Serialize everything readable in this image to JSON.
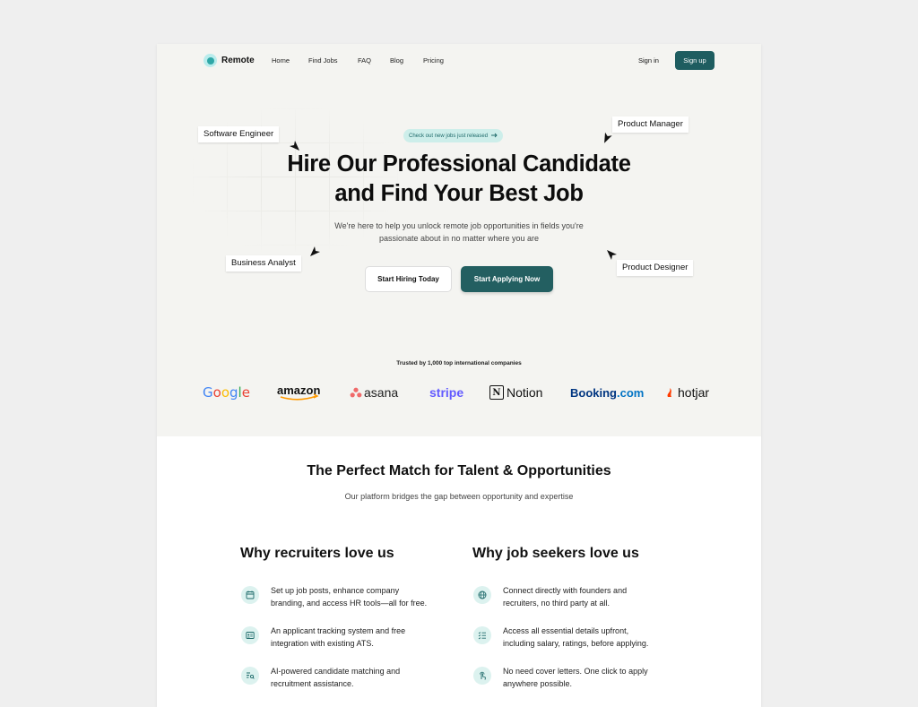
{
  "nav": {
    "brand": "Remote",
    "links": [
      "Home",
      "Find Jobs",
      "FAQ",
      "Blog",
      "Pricing"
    ],
    "signin": "Sign in",
    "signup": "Sign up"
  },
  "hero": {
    "announcement": "Check out new jobs just released",
    "headline_line1": "Hire Our Professional Candidate",
    "headline_line2": "and Find Your Best Job",
    "subtitle_line1": "We're here to help you unlock remote job opportunities in fields you're",
    "subtitle_line2": "passionate about in no matter where you are",
    "cta_hire": "Start Hiring Today",
    "cta_apply": "Start Applying Now",
    "tags": [
      "Software Engineer",
      "Product  Manager",
      "Business Analyst",
      "Product Designer"
    ]
  },
  "trusted": {
    "label": "Trusted by 1,000 top international companies",
    "companies": [
      "Google",
      "amazon",
      "asana",
      "stripe",
      "Notion",
      "Booking",
      ".com",
      "hotjar"
    ]
  },
  "match": {
    "title": "The Perfect Match for Talent & Opportunities",
    "subtitle": "Our platform bridges the gap between opportunity and expertise"
  },
  "recruiters": {
    "title": "Why recruiters love us",
    "items": [
      {
        "icon": "calendar-icon",
        "line1": "Set up job posts, enhance company",
        "line2": "branding, and access HR tools—all for free."
      },
      {
        "icon": "id-card-icon",
        "line1": "An applicant tracking system and free",
        "line2": "integration with existing ATS."
      },
      {
        "icon": "search-list-icon",
        "line1": "AI-powered candidate matching and",
        "line2": "recruitment assistance."
      }
    ]
  },
  "seekers": {
    "title": "Why job seekers love us",
    "items": [
      {
        "icon": "globe-icon",
        "line1": "Connect directly with founders and",
        "line2": "recruiters, no third party at all."
      },
      {
        "icon": "checklist-icon",
        "line1": "Access all essential details upfront,",
        "line2": "including salary, ratings, before applying."
      },
      {
        "icon": "tap-icon",
        "line1": "No need cover letters. One click to apply",
        "line2": "anywhere possible."
      }
    ]
  },
  "colors": {
    "primary": "#1e5d60",
    "hero_bg": "#f4f4f1",
    "accent_soft": "#dcf2ef",
    "google_blue": "#4285F4",
    "google_red": "#EA4335",
    "google_yellow": "#FBBC05",
    "google_green": "#34A853",
    "asana": "#F06A6A",
    "stripe": "#635BFF",
    "booking": "#003580",
    "booking_dot": "#0073c4",
    "hotjar": "#FF3C00",
    "amazon_arrow": "#FF9900"
  }
}
